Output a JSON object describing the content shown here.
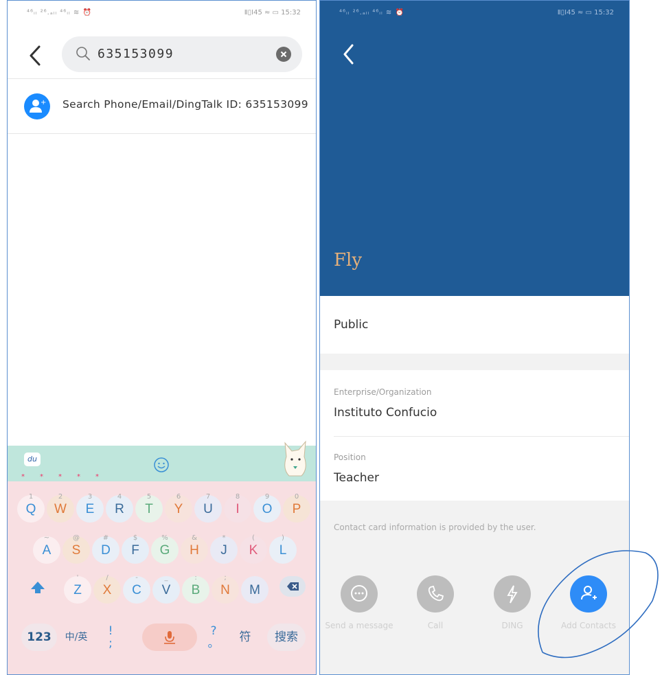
{
  "left": {
    "status_left": "⁴⁶ᵢₗ ²⁶.ₐₗₗ ⁴⁶ᵢₗ ≋ ⏰",
    "status_right": "Ⅱ▯I45 ≈ ▭ 15:32",
    "search_query": "635153099",
    "result_text": "Search Phone/Email/DingTalk ID: 635153099",
    "keyboard": {
      "row1": [
        [
          "1",
          "Q"
        ],
        [
          "2",
          "W"
        ],
        [
          "3",
          "E"
        ],
        [
          "4",
          "R"
        ],
        [
          "5",
          "T"
        ],
        [
          "6",
          "Y"
        ],
        [
          "7",
          "U"
        ],
        [
          "8",
          "I"
        ],
        [
          "9",
          "O"
        ],
        [
          "0",
          "P"
        ]
      ],
      "row2": [
        [
          "~",
          "A"
        ],
        [
          "@",
          "S"
        ],
        [
          "#",
          "D"
        ],
        [
          "$",
          "F"
        ],
        [
          "%",
          "G"
        ],
        [
          "&",
          "H"
        ],
        [
          "*",
          "J"
        ],
        [
          "(",
          "K"
        ],
        [
          ")",
          "L"
        ]
      ],
      "row3": [
        [
          "'",
          "Z"
        ],
        [
          "/",
          "X"
        ],
        [
          "-",
          "C"
        ],
        [
          "_",
          "V"
        ],
        [
          ":",
          "B"
        ],
        [
          ";",
          "N"
        ],
        [
          "",
          "M"
        ]
      ],
      "k123": "123",
      "lang": "中/英",
      "punct": "!",
      "punct2": "?",
      "fu": "符",
      "search": "搜索",
      "du": "du"
    }
  },
  "right": {
    "status_left": "⁴⁶ᵢₗ ²⁶.ₐₗₗ ⁴⁶ᵢₗ ≋ ⏰",
    "status_right": "Ⅱ▯I45 ≈ ▭ 15:32",
    "name": "Fly",
    "public_label": "Public",
    "enterprise_label": "Enterprise/Organization",
    "enterprise_value": "Instituto Confucio",
    "position_label": "Position",
    "position_value": "Teacher",
    "note": "Contact card information is provided by the user.",
    "actions": [
      {
        "label": "Send a message",
        "icon": "chat-icon"
      },
      {
        "label": "Call",
        "icon": "phone-icon"
      },
      {
        "label": "DING",
        "icon": "ding-bolt-icon"
      },
      {
        "label": "Add Contacts",
        "icon": "add-person-icon"
      }
    ]
  },
  "colors": {
    "hero": "#1f5b96",
    "primary": "#2e8cf7",
    "search_result_icon": "#1a8bff"
  }
}
